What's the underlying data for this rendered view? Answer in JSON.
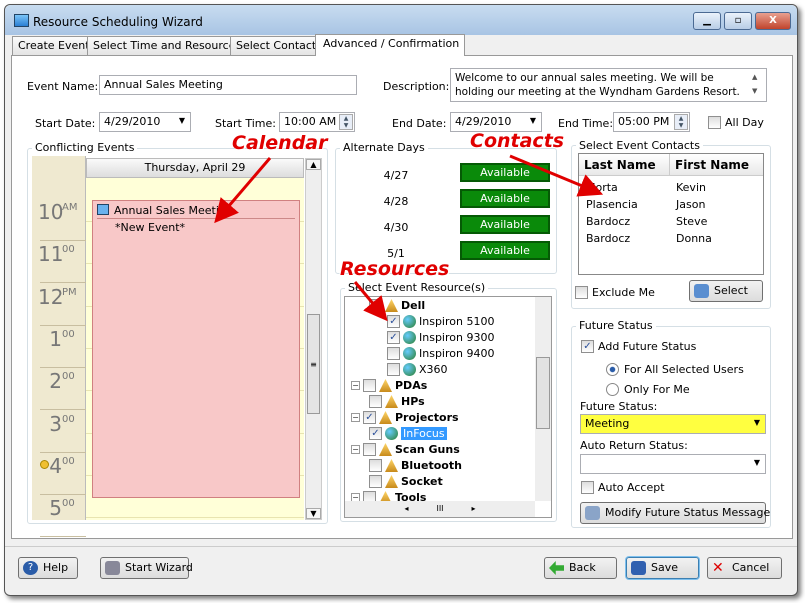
{
  "window": {
    "title": "Resource Scheduling Wizard"
  },
  "tabs": [
    {
      "label": "Create Event"
    },
    {
      "label": "Select Time and Resources"
    },
    {
      "label": "Select Contacts"
    },
    {
      "label": "Advanced / Confirmation",
      "active": true
    }
  ],
  "form": {
    "event_name_label": "Event Name:",
    "event_name": "Annual Sales Meeting",
    "description_label": "Description:",
    "description": "Welcome to our annual sales meeting.  We will be holding our meeting at the Wyndham Gardens Resort.  Please visit the",
    "start_date_label": "Start Date:",
    "start_date": "4/29/2010",
    "start_time_label": "Start Time:",
    "start_time": "10:00 AM",
    "end_date_label": "End Date:",
    "end_date": "4/29/2010",
    "end_time_label": "End Time:",
    "end_time": "05:00 PM",
    "all_day_label": "All Day",
    "all_day": false
  },
  "conflicts": {
    "title": "Conflicting Events",
    "day_header": "Thursday, April 29",
    "hours": [
      {
        "h": "10",
        "s": "AM"
      },
      {
        "h": "11",
        "s": "00"
      },
      {
        "h": "12",
        "s": "PM"
      },
      {
        "h": "1",
        "s": "00"
      },
      {
        "h": "2",
        "s": "00"
      },
      {
        "h": "3",
        "s": "00"
      },
      {
        "h": "4",
        "s": "00"
      },
      {
        "h": "5",
        "s": "00"
      }
    ],
    "event_title": "Annual Sales Meeting",
    "event_sub": "*New Event*",
    "event_color": "#f8c8c8"
  },
  "alternate": {
    "title": "Alternate Days",
    "days": [
      {
        "date": "4/27",
        "status": "Available"
      },
      {
        "date": "4/28",
        "status": "Available"
      },
      {
        "date": "4/30",
        "status": "Available"
      },
      {
        "date": "5/1",
        "status": "Available"
      }
    ]
  },
  "resources": {
    "title": "Select Event Resource(s)",
    "items": [
      {
        "label": "Dell",
        "bold": true,
        "checked": false,
        "icon": "folder-icon",
        "level": 1
      },
      {
        "label": "Inspiron 5100",
        "checked": true,
        "icon": "globe-icon",
        "level": 2
      },
      {
        "label": "Inspiron 9300",
        "checked": true,
        "icon": "globe-icon",
        "level": 2
      },
      {
        "label": "Inspiron 9400",
        "checked": false,
        "icon": "globe-icon",
        "level": 2
      },
      {
        "label": "X360",
        "checked": false,
        "icon": "globe-icon",
        "level": 2
      },
      {
        "label": "PDAs",
        "bold": true,
        "checked": false,
        "icon": "folder-icon",
        "level": 0
      },
      {
        "label": "HPs",
        "bold": true,
        "checked": false,
        "icon": "folder-icon",
        "level": 1
      },
      {
        "label": "Projectors",
        "bold": true,
        "checked": true,
        "icon": "folder-icon",
        "level": 0
      },
      {
        "label": "InFocus",
        "checked": true,
        "icon": "globe-icon",
        "level": 1,
        "selected": true
      },
      {
        "label": "Scan Guns",
        "bold": true,
        "checked": false,
        "icon": "folder-icon",
        "level": 0
      },
      {
        "label": "Bluetooth",
        "bold": true,
        "checked": false,
        "icon": "folder-icon",
        "level": 1
      },
      {
        "label": "Socket",
        "bold": true,
        "checked": false,
        "icon": "folder-icon",
        "level": 1
      },
      {
        "label": "Tools",
        "bold": true,
        "checked": false,
        "icon": "folder-icon",
        "level": 0
      }
    ]
  },
  "contacts": {
    "title": "Select Event Contacts",
    "columns": [
      "Last Name",
      "First Name"
    ],
    "rows": [
      [
        "Morta",
        "Kevin"
      ],
      [
        "Plasencia",
        "Jason"
      ],
      [
        "Bardocz",
        "Steve"
      ],
      [
        "Bardocz",
        "Donna"
      ]
    ],
    "exclude_me_label": "Exclude Me",
    "select_label": "Select"
  },
  "future": {
    "title": "Future Status",
    "add_label": "Add Future Status",
    "add_checked": true,
    "all_users_label": "For All Selected Users",
    "only_me_label": "Only For Me",
    "status_label": "Future Status:",
    "status_value": "Meeting",
    "status_color": "#ffff40",
    "auto_return_label": "Auto Return Status:",
    "auto_return_value": "",
    "auto_accept_label": "Auto Accept",
    "modify_label": "Modify Future Status Message"
  },
  "buttons": {
    "help": "Help",
    "start_wizard": "Start Wizard",
    "back": "Back",
    "save": "Save",
    "cancel": "Cancel"
  },
  "annotations": {
    "calendar": "Calendar",
    "contacts": "Contacts",
    "resources": "Resources"
  }
}
